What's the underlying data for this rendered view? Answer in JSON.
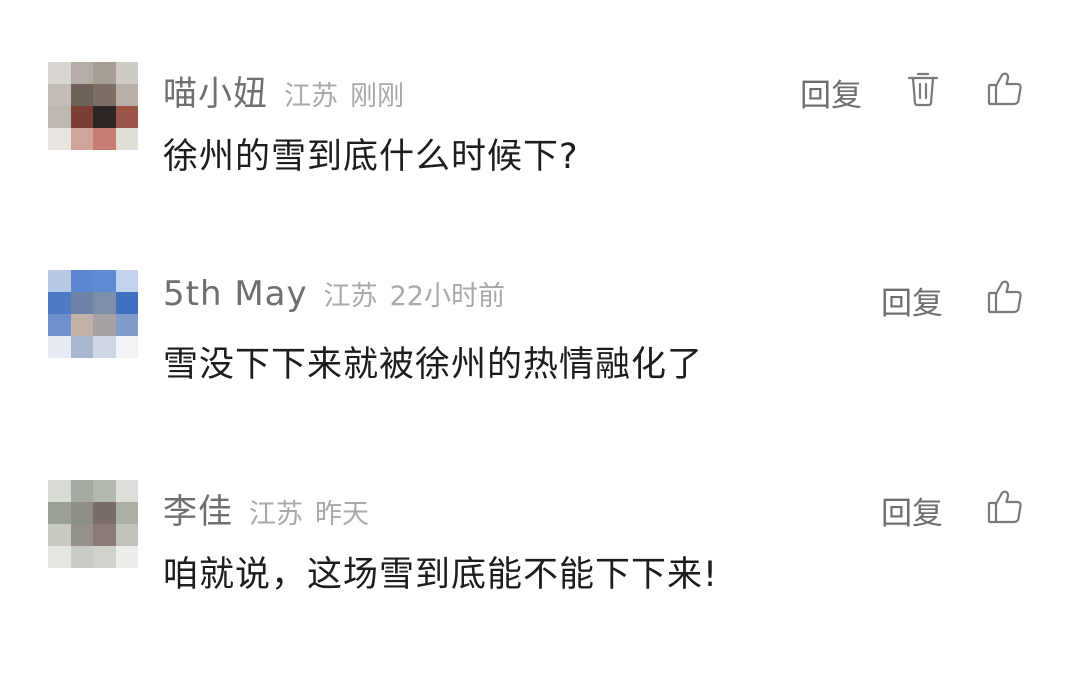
{
  "comments": [
    {
      "username": "喵小妞",
      "location": "江苏",
      "time": "刚刚",
      "text": "徐州的雪到底什么时候下?",
      "reply_label": "回复",
      "has_delete": true,
      "delete_icon": "trash-icon",
      "like_icon": "thumbs-up-icon"
    },
    {
      "username": "5th May",
      "location": "江苏",
      "time": "22小时前",
      "text": "雪没下下来就被徐州的热情融化了",
      "reply_label": "回复",
      "has_delete": false,
      "like_icon": "thumbs-up-icon"
    },
    {
      "username": "李佳",
      "location": "江苏",
      "time": "昨天",
      "text": "咱就说，这场雪到底能不能下下来!",
      "reply_label": "回复",
      "has_delete": false,
      "like_icon": "thumbs-up-icon"
    }
  ],
  "colors": {
    "username": "#6f6f6f",
    "meta": "#a9a9a9",
    "text": "#1d1d1d",
    "icon": "#7a7a7a"
  }
}
